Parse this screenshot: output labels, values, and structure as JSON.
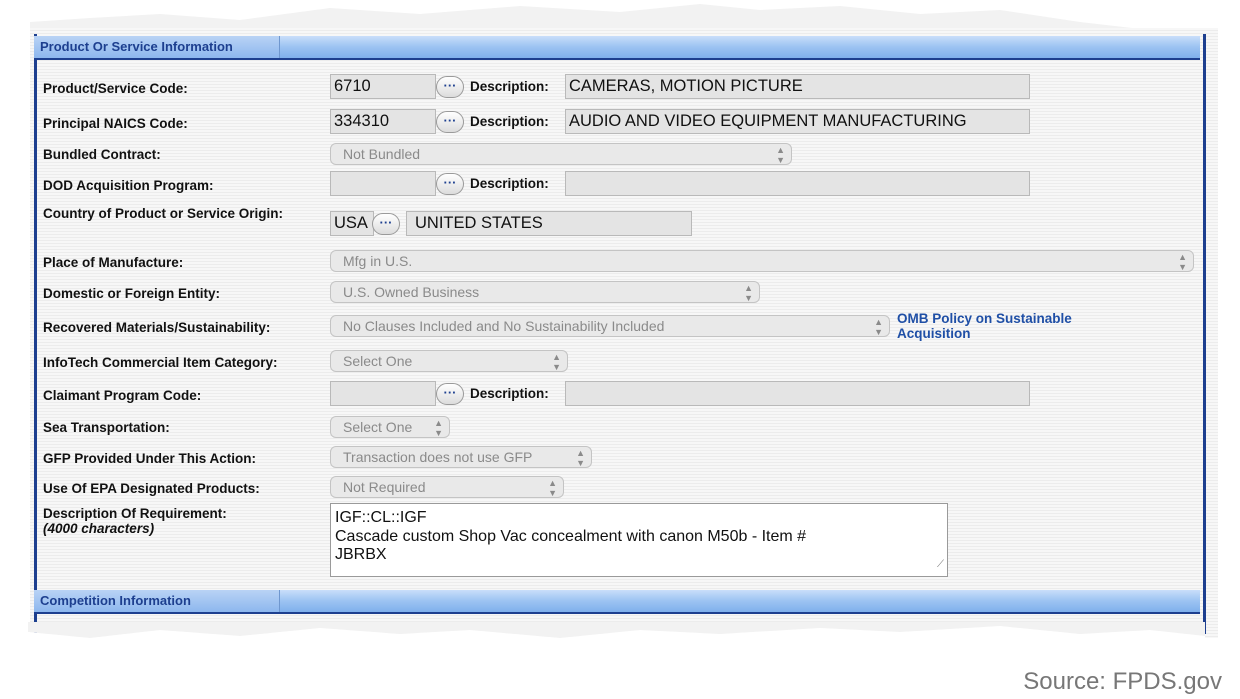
{
  "sections": {
    "product_title": "Product Or Service Information",
    "competition_title": "Competition Information"
  },
  "fields": {
    "psc_label": "Product/Service Code:",
    "psc_value": "6710",
    "psc_desc_label": "Description:",
    "psc_desc": "CAMERAS, MOTION PICTURE",
    "naics_label": "Principal NAICS Code:",
    "naics_value": "334310",
    "naics_desc_label": "Description:",
    "naics_desc": "AUDIO AND VIDEO EQUIPMENT MANUFACTURING",
    "bundled_label": "Bundled Contract:",
    "bundled_value": "Not Bundled",
    "dod_label": "DOD Acquisition Program:",
    "dod_value": "",
    "dod_desc_label": "Description:",
    "dod_desc": "",
    "country_label": "Country of Product or Service Origin:",
    "country_code": "USA",
    "country_name": "UNITED STATES",
    "place_label": "Place of Manufacture:",
    "place_value": "Mfg in U.S.",
    "entity_label": "Domestic or Foreign Entity:",
    "entity_value": "U.S. Owned Business",
    "recovered_label": "Recovered Materials/Sustainability:",
    "recovered_value": "No Clauses Included and No Sustainability Included",
    "omb_link": "OMB Policy on Sustainable Acquisition",
    "infotech_label": "InfoTech Commercial Item Category:",
    "infotech_value": "Select One",
    "claimant_label": "Claimant Program Code:",
    "claimant_value": "",
    "claimant_desc_label": "Description:",
    "claimant_desc": "",
    "sea_label": "Sea Transportation:",
    "sea_value": "Select One",
    "gfp_label": "GFP Provided Under This Action:",
    "gfp_value": "Transaction does not use GFP",
    "epa_label": "Use Of EPA Designated Products:",
    "epa_value": "Not Required",
    "req_label": "Description Of Requirement:",
    "req_sublabel": "(4000 characters)",
    "req_value": "IGF::CL::IGF\nCascade custom Shop Vac concealment with canon M50b - Item #\nJBRBX"
  },
  "icons": {
    "lookup": "ellipsis-lookup-icon",
    "select_arrows": "updown-arrows-icon"
  },
  "source": "Source: FPDS.gov",
  "colors": {
    "accent": "#1d3f8f",
    "section_bar": "#9cc3f2",
    "link": "#1f4fa6"
  }
}
